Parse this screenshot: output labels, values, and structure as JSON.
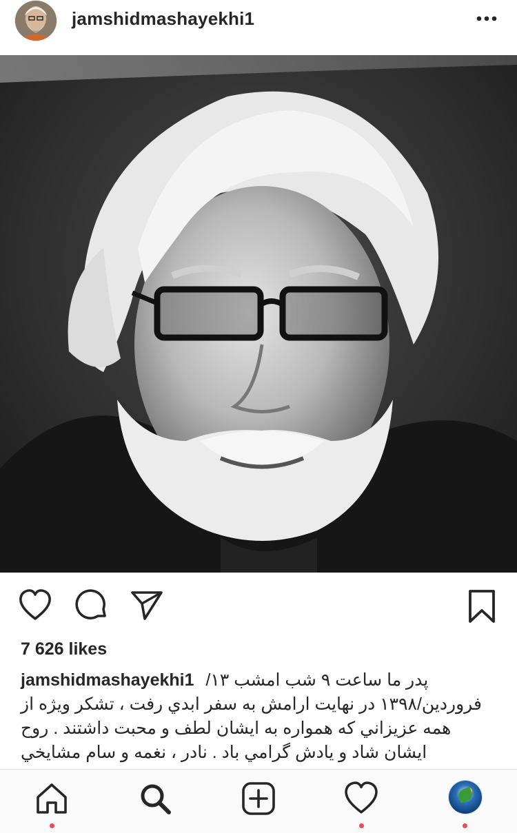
{
  "post": {
    "username": "jamshidmashayekhi1",
    "likes": "7 626 likes",
    "caption_user": "jamshidmashayekhi1",
    "caption_lines": [
      "پدر ما ساعت ۹ شب امشب ۱۳/",
      "فروردين/۱۳۹۸ در نهايت ارامش به سفر ابدي رفت ، تشکر ويژه از",
      "همه عزيزاني که همواره به ايشان لطف و محبت داشتند . روح",
      "ايشان شاد و يادش گرامي باد . نادر ، نغمه و سام مشايخي"
    ]
  },
  "icons": {
    "header_avatar": "avatar-icon",
    "more": "more-options-icon",
    "like": "heart-icon",
    "comment": "comment-icon",
    "share": "send-icon",
    "save": "bookmark-icon",
    "home": "home-icon",
    "search": "search-icon",
    "new_post": "add-post-icon",
    "activity": "heart-icon",
    "profile": "profile-avatar-icon"
  },
  "colors": {
    "text": "#262626",
    "notification_dot": "#ed4956",
    "tabbar_bg": "#fafafa",
    "divider": "#dbdbdb"
  }
}
